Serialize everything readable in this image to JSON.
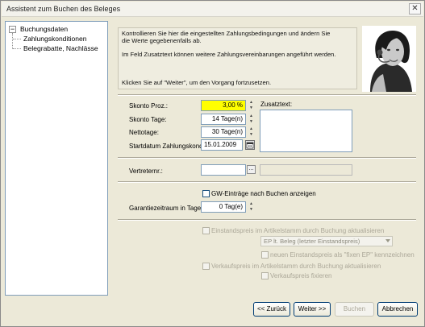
{
  "window": {
    "title": "Assistent zum Buchen des Beleges",
    "close_glyph": "✕"
  },
  "tree": {
    "toggle_glyph": "−",
    "root": "Buchungsdaten",
    "children": [
      "Zahlungskonditionen",
      "Belegrabatte, Nachlässe"
    ]
  },
  "info": {
    "line1": "Kontrollieren Sie hier die eingestellten Zahlungsbedingungen und ändern Sie",
    "line2": "die Werte gegebenenfalls ab.",
    "line3": "Im Feld Zusatztext können weitere Zahlungsvereinbarungen angeführt werden.",
    "line4": "Klicken Sie auf \"Weiter\", um den Vorgang fortzusetzen."
  },
  "form": {
    "skonto_proz_label": "Skonto Proz.:",
    "skonto_proz_value": "3,00 %",
    "skonto_tage_label": "Skonto Tage:",
    "skonto_tage_value": "14 Tage(n)",
    "nettotage_label": "Nettotage:",
    "nettotage_value": "30 Tage(n)",
    "startdatum_label": "Startdatum Zahlungskond.:",
    "startdatum_value": "15.01.2009",
    "zusatztext_label": "Zusatztext:",
    "vertreter_label": "Vertreternr.:",
    "vertreter_value": "",
    "lookup_glyph": "...",
    "gw_label": "GW-Einträge nach Buchen anzeigen",
    "garantie_label": "Garantiezeitraum in Tagen:",
    "garantie_value": "0 Tag(e)",
    "einstandspreis_label": "Einstandspreis im Artikelstamm durch Buchung aktualisieren",
    "ep_combo_value": "EP lt. Beleg (letzter Einstandspreis)",
    "neuer_ep_label": "neuen Einstandspreis als \"fixen EP\" kennzeichnen",
    "verkaufspreis_label": "Verkaufspreis im Artikelstamm durch Buchung aktualisieren",
    "vk_fixieren_label": "Verkaufspreis fixieren"
  },
  "buttons": {
    "back": "<< Zurück",
    "next": "Weiter >>",
    "book": "Buchen",
    "cancel": "Abbrechen"
  },
  "colors": {
    "highlight_field": "#ffff00",
    "window_bg": "#ece9d8"
  }
}
